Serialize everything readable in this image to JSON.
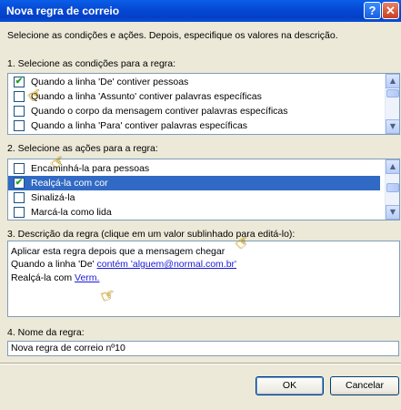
{
  "window": {
    "title": "Nova regra de correio",
    "help": "?",
    "close": "✕"
  },
  "intro": "Selecione as condições e ações. Depois, especifique os valores na descrição.",
  "conditions": {
    "label": "1. Selecione as condições para a regra:",
    "items": [
      {
        "label": "Quando a linha 'De' contiver pessoas",
        "checked": true
      },
      {
        "label": "Quando a linha 'Assunto' contiver palavras específicas",
        "checked": false
      },
      {
        "label": "Quando o corpo da mensagem contiver palavras específicas",
        "checked": false
      },
      {
        "label": "Quando a linha 'Para' contiver palavras específicas",
        "checked": false
      }
    ]
  },
  "actions": {
    "label": "2. Selecione as ações para a regra:",
    "items": [
      {
        "label": "Encaminhá-la para pessoas",
        "checked": false
      },
      {
        "label": "Realçá-la com cor",
        "checked": true,
        "selected": true
      },
      {
        "label": "Sinalizá-la",
        "checked": false
      },
      {
        "label": "Marcá-la como lida",
        "checked": false
      }
    ]
  },
  "description": {
    "label": "3. Descrição da regra (clique em um valor sublinhado para editá-lo):",
    "line1": "Aplicar esta regra depois que a mensagem chegar",
    "line2_prefix": "Quando a linha 'De' ",
    "line2_link": "contém 'alguem@normal.com.br'",
    "line3_prefix": "Realçá-la com ",
    "line3_link": "Verm."
  },
  "name": {
    "label": "4. Nome da regra:",
    "value": "Nova regra de correio nº10"
  },
  "buttons": {
    "ok": "OK",
    "cancel": "Cancelar"
  },
  "icons": {
    "check": "✔",
    "up": "▲",
    "down": "▼",
    "pointer": "☞"
  }
}
